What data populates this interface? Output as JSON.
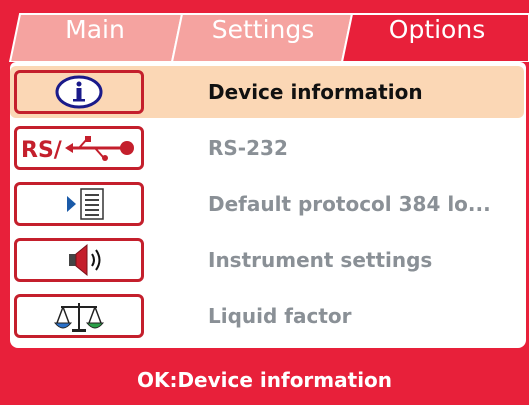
{
  "tabs": [
    {
      "label": "Main",
      "active": false
    },
    {
      "label": "Settings",
      "active": false
    },
    {
      "label": "Options",
      "active": true
    }
  ],
  "menu": [
    {
      "label": "Device information",
      "icon": "info-icon",
      "selected": true
    },
    {
      "label": "RS-232",
      "icon": "rs232-usb-icon",
      "icon_text": "RS/",
      "selected": false
    },
    {
      "label": "Default protocol 384 lo...",
      "icon": "protocol-list-icon",
      "selected": false
    },
    {
      "label": "Instrument settings",
      "icon": "speaker-icon",
      "selected": false
    },
    {
      "label": "Liquid factor",
      "icon": "balance-scale-icon",
      "selected": false
    }
  ],
  "status": {
    "text": "OK:Device information"
  },
  "colors": {
    "frame": "#e8203a",
    "selected_row": "#fbd7b5",
    "inactive_tab": "#f5a3a0",
    "icon_border": "#c41f2c",
    "text_inactive": "#8a9096"
  }
}
